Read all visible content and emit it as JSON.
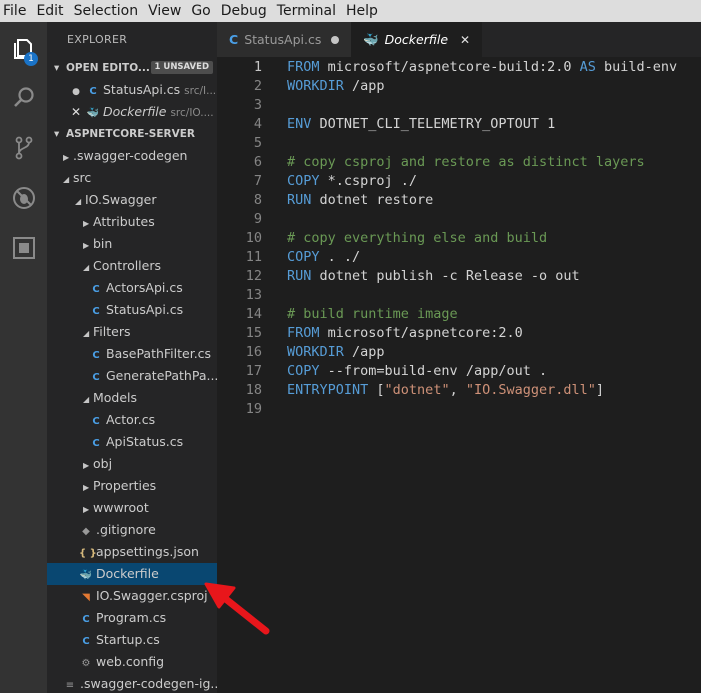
{
  "menu": [
    "File",
    "Edit",
    "Selection",
    "View",
    "Go",
    "Debug",
    "Terminal",
    "Help"
  ],
  "activity": {
    "explorer_badge": "1"
  },
  "sidebar": {
    "title": "EXPLORER",
    "open_editors": {
      "label": "OPEN EDITO...",
      "unsaved": "1 UNSAVED",
      "items": [
        {
          "name": "StatusApi.cs",
          "path": "src/I..."
        },
        {
          "name": "Dockerfile",
          "path": "src/IO...."
        }
      ]
    },
    "project": {
      "label": "ASPNETCORE-SERVER"
    },
    "tree": [
      {
        "label": ".swagger-codegen",
        "kind": "folder",
        "open": false,
        "indent": 16
      },
      {
        "label": "src",
        "kind": "folder",
        "open": true,
        "indent": 16
      },
      {
        "label": "IO.Swagger",
        "kind": "folder",
        "open": true,
        "indent": 28
      },
      {
        "label": "Attributes",
        "kind": "folder",
        "open": false,
        "indent": 36
      },
      {
        "label": "bin",
        "kind": "folder",
        "open": false,
        "indent": 36
      },
      {
        "label": "Controllers",
        "kind": "folder",
        "open": true,
        "indent": 36
      },
      {
        "label": "ActorsApi.cs",
        "kind": "cs",
        "indent": 42
      },
      {
        "label": "StatusApi.cs",
        "kind": "cs",
        "indent": 42
      },
      {
        "label": "Filters",
        "kind": "folder",
        "open": true,
        "indent": 36
      },
      {
        "label": "BasePathFilter.cs",
        "kind": "cs",
        "indent": 42
      },
      {
        "label": "GeneratePathPa...",
        "kind": "cs",
        "indent": 42
      },
      {
        "label": "Models",
        "kind": "folder",
        "open": true,
        "indent": 36
      },
      {
        "label": "Actor.cs",
        "kind": "cs",
        "indent": 42
      },
      {
        "label": "ApiStatus.cs",
        "kind": "cs",
        "indent": 42
      },
      {
        "label": "obj",
        "kind": "folder",
        "open": false,
        "indent": 36
      },
      {
        "label": "Properties",
        "kind": "folder",
        "open": false,
        "indent": 36
      },
      {
        "label": "wwwroot",
        "kind": "folder",
        "open": false,
        "indent": 36
      },
      {
        "label": ".gitignore",
        "kind": "git",
        "indent": 32
      },
      {
        "label": "appsettings.json",
        "kind": "json",
        "indent": 32
      },
      {
        "label": "Dockerfile",
        "kind": "docker",
        "indent": 32,
        "selected": true
      },
      {
        "label": "IO.Swagger.csproj",
        "kind": "rss",
        "indent": 32
      },
      {
        "label": "Program.cs",
        "kind": "cs",
        "indent": 32
      },
      {
        "label": "Startup.cs",
        "kind": "cs",
        "indent": 32
      },
      {
        "label": "web.config",
        "kind": "gear",
        "indent": 32
      },
      {
        "label": ".swagger-codegen-ig...",
        "kind": "lines",
        "indent": 16
      }
    ]
  },
  "tabs": [
    {
      "name": "StatusApi.cs",
      "state": "modified"
    },
    {
      "name": "Dockerfile",
      "state": "active"
    }
  ],
  "editor": {
    "current_line": 1,
    "lines": [
      [
        [
          "kw",
          "FROM"
        ],
        [
          "pl",
          " microsoft/aspnetcore-build:2.0 "
        ],
        [
          "kw",
          "AS"
        ],
        [
          "pl",
          " build-env"
        ]
      ],
      [
        [
          "kw",
          "WORKDIR"
        ],
        [
          "pl",
          " /app"
        ]
      ],
      [],
      [
        [
          "kw",
          "ENV"
        ],
        [
          "pl",
          " DOTNET_CLI_TELEMETRY_OPTOUT 1"
        ]
      ],
      [],
      [
        [
          "cm",
          "# copy csproj and restore as distinct layers"
        ]
      ],
      [
        [
          "kw",
          "COPY"
        ],
        [
          "pl",
          " *.csproj ./"
        ]
      ],
      [
        [
          "kw",
          "RUN"
        ],
        [
          "pl",
          " dotnet restore"
        ]
      ],
      [],
      [
        [
          "cm",
          "# copy everything else and build"
        ]
      ],
      [
        [
          "kw",
          "COPY"
        ],
        [
          "pl",
          " . ./"
        ]
      ],
      [
        [
          "kw",
          "RUN"
        ],
        [
          "pl",
          " dotnet publish -c Release -o out"
        ]
      ],
      [],
      [
        [
          "cm",
          "# build runtime image"
        ]
      ],
      [
        [
          "kw",
          "FROM"
        ],
        [
          "pl",
          " microsoft/aspnetcore:2.0"
        ]
      ],
      [
        [
          "kw",
          "WORKDIR"
        ],
        [
          "pl",
          " /app"
        ]
      ],
      [
        [
          "kw",
          "COPY"
        ],
        [
          "pl",
          " --from=build-env /app/out ."
        ]
      ],
      [
        [
          "kw",
          "ENTRYPOINT"
        ],
        [
          "pl",
          " ["
        ],
        [
          "st",
          "\"dotnet\""
        ],
        [
          "pl",
          ", "
        ],
        [
          "st",
          "\"IO.Swagger.dll\""
        ],
        [
          "pl",
          "]"
        ]
      ],
      []
    ]
  },
  "colors": {
    "keyword": "#569cd6",
    "comment": "#6a9955",
    "string": "#ce9178",
    "selection": "#094771",
    "arrow": "#e8161b"
  }
}
